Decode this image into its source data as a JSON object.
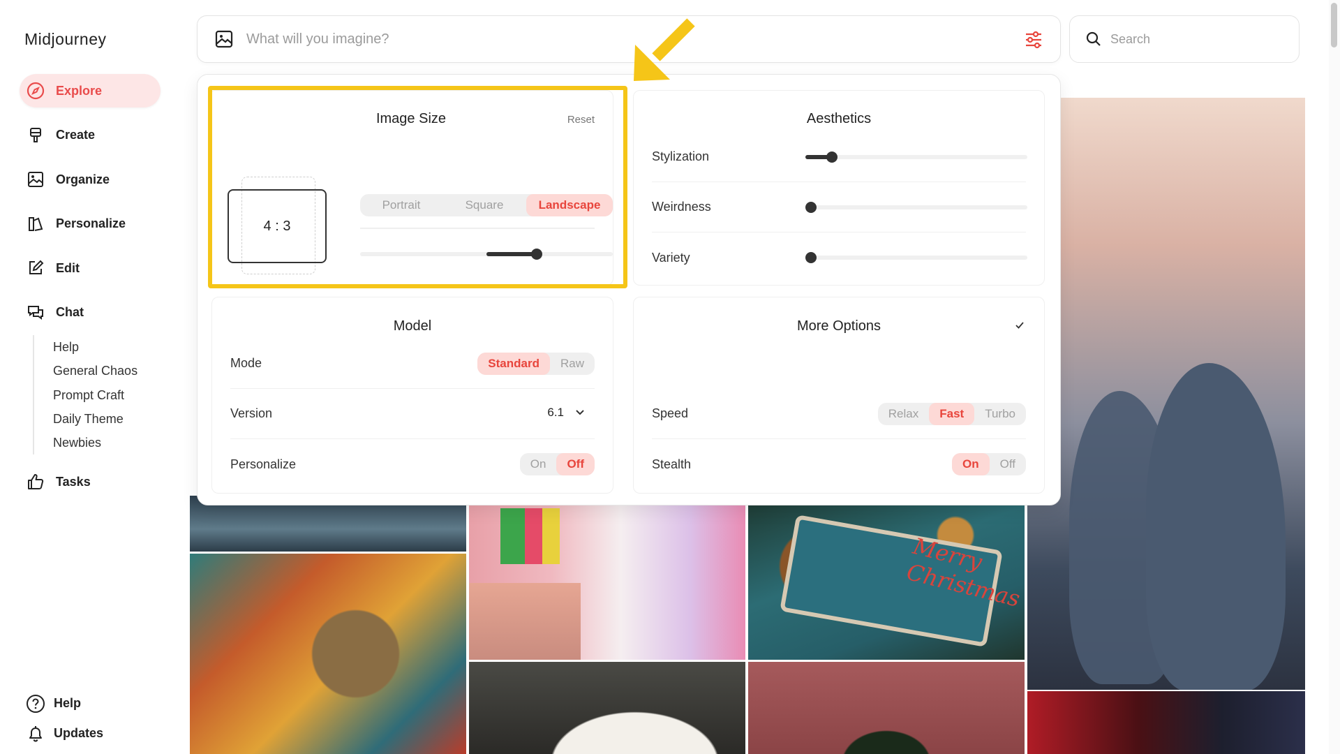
{
  "sidebar": {
    "brand": "Midjourney",
    "items": [
      {
        "label": "Explore",
        "icon": "compass-icon"
      },
      {
        "label": "Create",
        "icon": "brush-icon"
      },
      {
        "label": "Organize",
        "icon": "image-icon"
      },
      {
        "label": "Personalize",
        "icon": "personalize-icon"
      },
      {
        "label": "Edit",
        "icon": "edit-icon"
      },
      {
        "label": "Chat",
        "icon": "chat-icon"
      }
    ],
    "chat_rooms": [
      "Help",
      "General Chaos",
      "Prompt Craft",
      "Daily Theme",
      "Newbies"
    ],
    "tasks_label": "Tasks",
    "bottom": [
      {
        "label": "Help",
        "icon": "help-icon"
      },
      {
        "label": "Updates",
        "icon": "bell-icon"
      }
    ],
    "accent_color": "#e94b4b"
  },
  "prompt": {
    "placeholder": "What will you imagine?"
  },
  "search": {
    "placeholder": "Search"
  },
  "settings": {
    "image_size": {
      "title": "Image Size",
      "reset_label": "Reset",
      "ratio": "4 : 3",
      "orientations": [
        "Portrait",
        "Square",
        "Landscape"
      ],
      "selected": "Landscape"
    },
    "aesthetics": {
      "title": "Aesthetics",
      "rows": [
        {
          "label": "Stylization",
          "level": 0.12
        },
        {
          "label": "Weirdness",
          "level": 0
        },
        {
          "label": "Variety",
          "level": 0
        }
      ]
    },
    "model": {
      "title": "Model",
      "mode_label": "Mode",
      "mode_options": [
        "Standard",
        "Raw"
      ],
      "mode_selected": "Standard",
      "version_label": "Version",
      "version_value": "6.1",
      "personalize_label": "Personalize",
      "personalize_options": [
        "On",
        "Off"
      ],
      "personalize_selected": "Off"
    },
    "more_options": {
      "title": "More Options",
      "speed_label": "Speed",
      "speed_options": [
        "Relax",
        "Fast",
        "Turbo"
      ],
      "speed_selected": "Fast",
      "stealth_label": "Stealth",
      "stealth_options": [
        "On",
        "Off"
      ],
      "stealth_selected": "On"
    }
  },
  "gallery": {
    "ginger_text": "Merry Christmas"
  },
  "colors": {
    "highlight": "#f5c518",
    "selected_bg": "#fdd9d6",
    "selected_text": "#e8453c"
  }
}
